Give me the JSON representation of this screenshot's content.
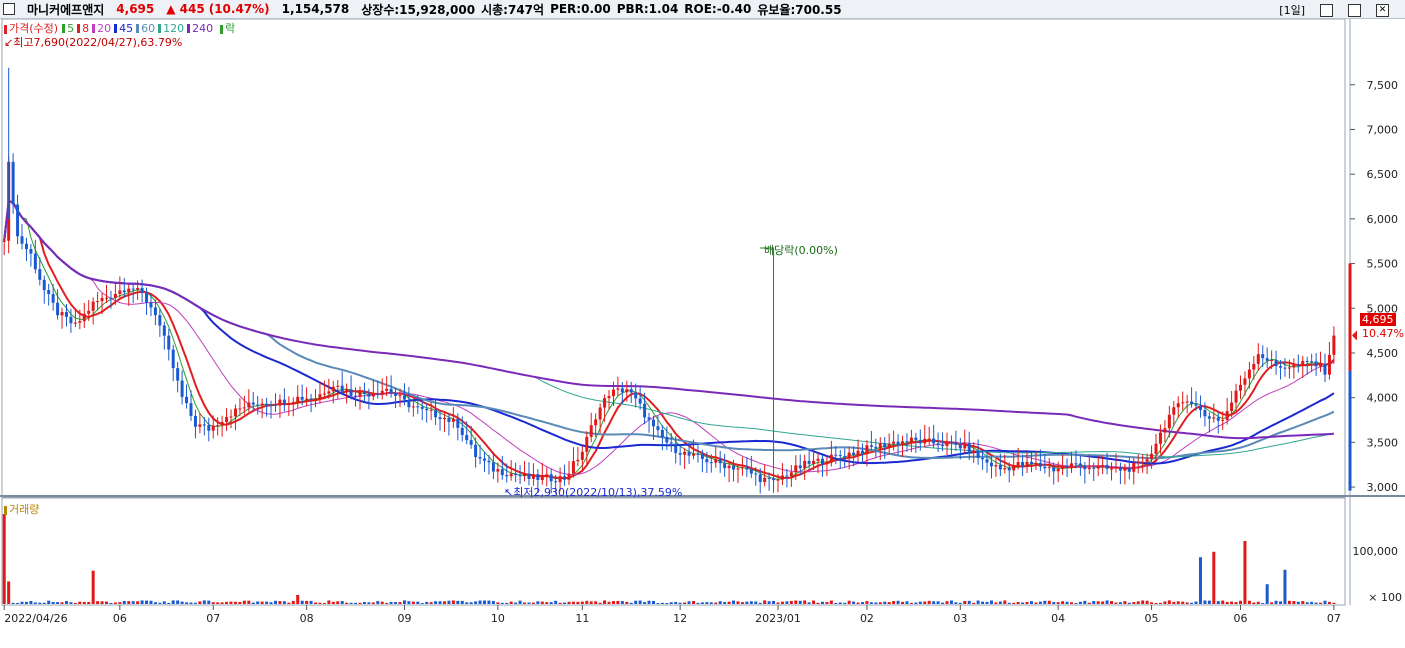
{
  "header": {
    "stock_name": "마니커에프앤지",
    "price": "4,695",
    "change": "▲ 445",
    "change_pct": "(10.47%)",
    "volume": "1,154,578",
    "listed_shares": "상장수:15,928,000",
    "market_cap": "시총:747억",
    "per": "PER:0.00",
    "pbr": "PBR:1.04",
    "roe": "ROE:-0.40",
    "reserve": "유보율:700.55",
    "period": "[1일]"
  },
  "legend": {
    "price_label": "가격(수정)",
    "ma_labels": [
      "5",
      "8",
      "20",
      "45",
      "60",
      "120",
      "240"
    ],
    "ma_colors": [
      "#2e9e2e",
      "#e02020",
      "#c040c0",
      "#1a2ad0",
      "#5a8ab8",
      "#30a890",
      "#7a2ab8"
    ],
    "drop_label": "락",
    "volume_label": "거래량"
  },
  "annotations": {
    "high": "최고7,690(2022/04/27),63.79%",
    "low": "최저2,930(2022/10/13),37.59%",
    "dividend": "배당락(0.00%)",
    "last_price": "4,695",
    "last_pct": "10.47%"
  },
  "chart_data": {
    "type": "candlestick",
    "x_range": [
      "2022/04/26",
      "2023/07"
    ],
    "price_ylim": [
      2900,
      7900
    ],
    "price_ticks": [
      "7,500",
      "7,000",
      "6,500",
      "6,000",
      "5,500",
      "5,000",
      "4,500",
      "4,000",
      "3,500",
      "3,000"
    ],
    "volume_ticks": [
      "100,000",
      "× 100"
    ],
    "x_ticks": [
      {
        "label": "2022/04/26",
        "i": 0
      },
      {
        "label": "06",
        "i": 26
      },
      {
        "label": "07",
        "i": 47
      },
      {
        "label": "08",
        "i": 68
      },
      {
        "label": "09",
        "i": 90
      },
      {
        "label": "10",
        "i": 111
      },
      {
        "label": "11",
        "i": 130
      },
      {
        "label": "12",
        "i": 152
      },
      {
        "label": "2023/01",
        "i": 174
      },
      {
        "label": "02",
        "i": 194
      },
      {
        "label": "03",
        "i": 215
      },
      {
        "label": "04",
        "i": 237
      },
      {
        "label": "05",
        "i": 258
      },
      {
        "label": "06",
        "i": 278
      },
      {
        "label": "07",
        "i": 299
      }
    ],
    "anchors": [
      [
        0,
        5800
      ],
      [
        1,
        6600
      ],
      [
        3,
        5800
      ],
      [
        6,
        5600
      ],
      [
        9,
        5200
      ],
      [
        12,
        4950
      ],
      [
        16,
        4800
      ],
      [
        20,
        5050
      ],
      [
        24,
        5150
      ],
      [
        28,
        5250
      ],
      [
        31,
        5150
      ],
      [
        34,
        4950
      ],
      [
        37,
        4500
      ],
      [
        40,
        4000
      ],
      [
        43,
        3700
      ],
      [
        46,
        3650
      ],
      [
        50,
        3800
      ],
      [
        54,
        3900
      ],
      [
        58,
        3950
      ],
      [
        62,
        3950
      ],
      [
        66,
        4000
      ],
      [
        70,
        4000
      ],
      [
        74,
        4150
      ],
      [
        78,
        4050
      ],
      [
        82,
        4050
      ],
      [
        86,
        4100
      ],
      [
        90,
        3950
      ],
      [
        94,
        3850
      ],
      [
        98,
        3800
      ],
      [
        102,
        3700
      ],
      [
        106,
        3350
      ],
      [
        110,
        3200
      ],
      [
        114,
        3150
      ],
      [
        118,
        3100
      ],
      [
        122,
        3100
      ],
      [
        126,
        3100
      ],
      [
        130,
        3400
      ],
      [
        133,
        3800
      ],
      [
        136,
        4050
      ],
      [
        140,
        4100
      ],
      [
        143,
        3900
      ],
      [
        146,
        3650
      ],
      [
        150,
        3450
      ],
      [
        154,
        3350
      ],
      [
        158,
        3300
      ],
      [
        162,
        3250
      ],
      [
        166,
        3200
      ],
      [
        170,
        3100
      ],
      [
        173,
        3050
      ],
      [
        176,
        3150
      ],
      [
        180,
        3250
      ],
      [
        184,
        3300
      ],
      [
        188,
        3350
      ],
      [
        192,
        3400
      ],
      [
        196,
        3450
      ],
      [
        200,
        3500
      ],
      [
        204,
        3520
      ],
      [
        208,
        3500
      ],
      [
        212,
        3480
      ],
      [
        216,
        3450
      ],
      [
        220,
        3300
      ],
      [
        224,
        3200
      ],
      [
        228,
        3250
      ],
      [
        232,
        3250
      ],
      [
        236,
        3200
      ],
      [
        240,
        3250
      ],
      [
        244,
        3230
      ],
      [
        248,
        3200
      ],
      [
        252,
        3200
      ],
      [
        256,
        3250
      ],
      [
        258,
        3400
      ],
      [
        262,
        3800
      ],
      [
        266,
        4000
      ],
      [
        270,
        3800
      ],
      [
        274,
        3750
      ],
      [
        278,
        4150
      ],
      [
        282,
        4500
      ],
      [
        286,
        4350
      ],
      [
        290,
        4350
      ],
      [
        294,
        4400
      ],
      [
        297,
        4300
      ],
      [
        299,
        4695
      ]
    ],
    "volume_spikes": [
      [
        0,
        100
      ],
      [
        1,
        25
      ],
      [
        20,
        37
      ],
      [
        66,
        10
      ],
      [
        269,
        52
      ],
      [
        272,
        58
      ],
      [
        279,
        70
      ],
      [
        284,
        22
      ],
      [
        288,
        38
      ],
      [
        300,
        8
      ]
    ],
    "n_bars": 300
  }
}
